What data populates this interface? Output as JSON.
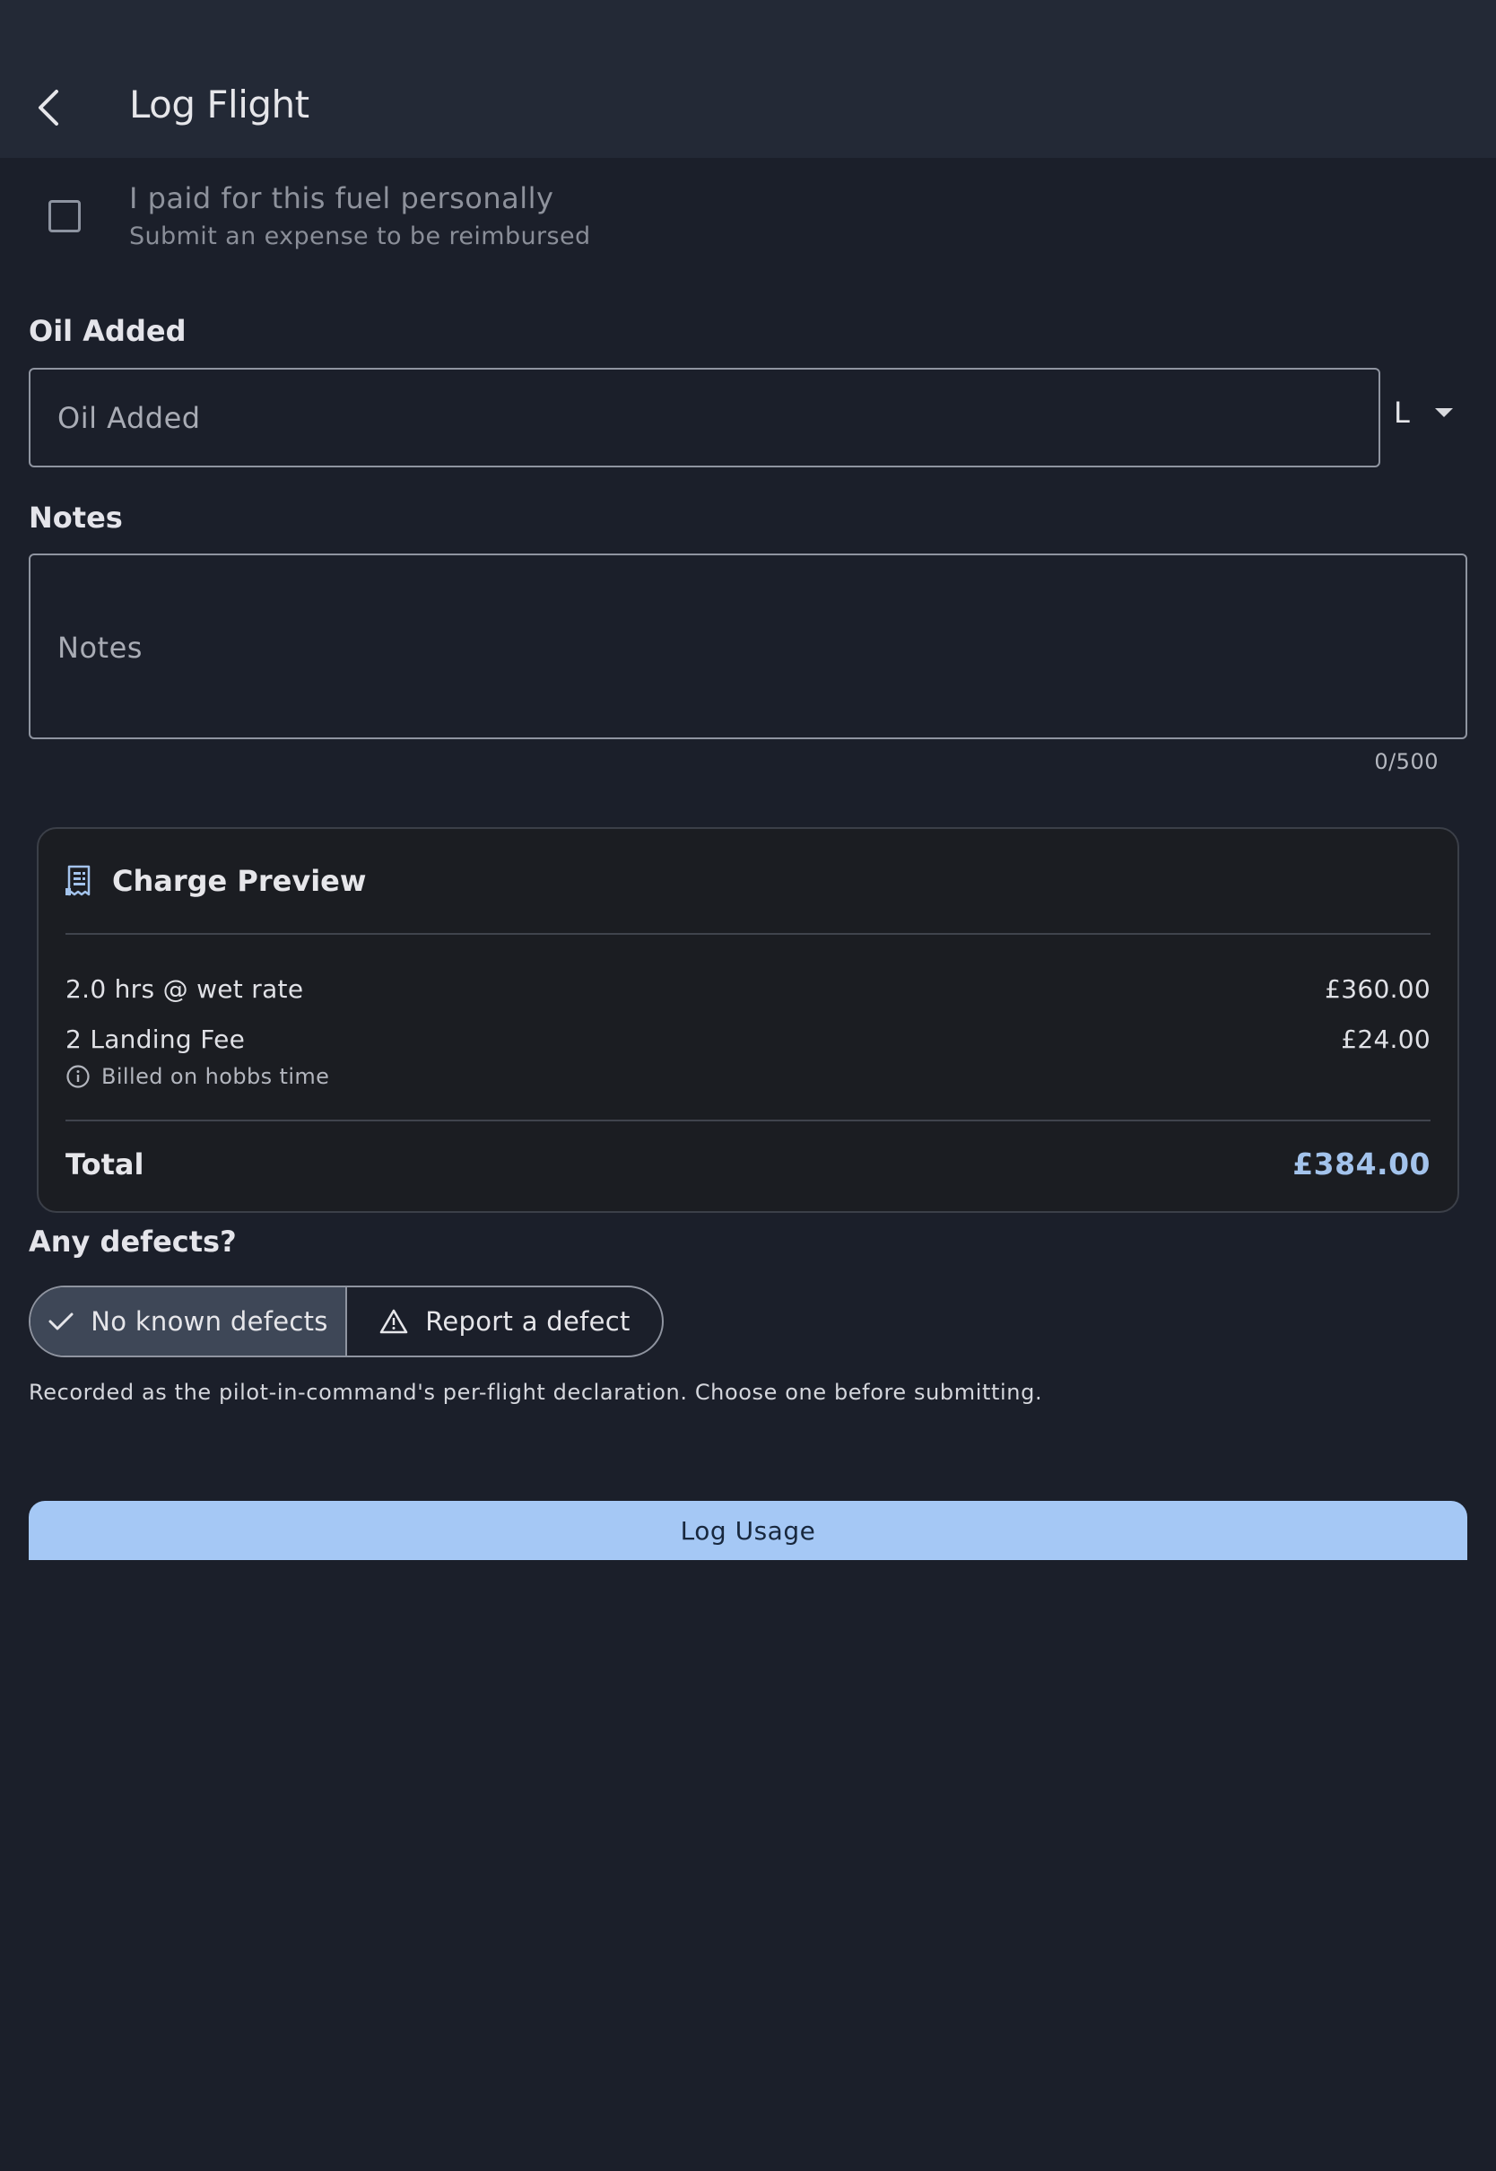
{
  "header": {
    "title": "Log Flight"
  },
  "fuel": {
    "checked": false,
    "title": "I paid for this fuel personally",
    "subtitle": "Submit an expense to be reimbursed"
  },
  "oil": {
    "label": "Oil Added",
    "placeholder": "Oil Added",
    "value": "",
    "unit": "L"
  },
  "notes": {
    "label": "Notes",
    "placeholder": "Notes",
    "value": "",
    "counter": "0/500"
  },
  "charge_preview": {
    "title": "Charge Preview",
    "lines": [
      {
        "label": "2.0 hrs @ wet rate",
        "amount": "£360.00"
      },
      {
        "label": "2 Landing Fee",
        "amount": "£24.00"
      }
    ],
    "note": "Billed on hobbs time",
    "total_label": "Total",
    "total_value": "£384.00"
  },
  "defects": {
    "label": "Any defects?",
    "options": [
      {
        "label": "No known defects",
        "selected": true
      },
      {
        "label": "Report a defect",
        "selected": false
      }
    ],
    "declaration": "Recorded as the pilot-in-command's per-flight declaration. Choose one before submitting."
  },
  "submit": {
    "label": "Log Usage"
  },
  "colors": {
    "background": "#1b1f2a",
    "appbar": "#232936",
    "accent": "#a5c8f5",
    "total": "#a3c3ec",
    "selected_segment": "#3e4757"
  }
}
